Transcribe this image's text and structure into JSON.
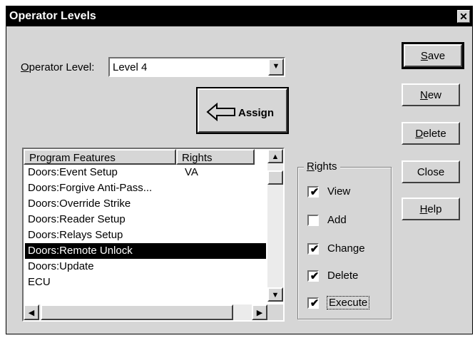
{
  "window": {
    "title": "Operator Levels",
    "close_glyph": "✕"
  },
  "operator_level": {
    "label_prefix": "O",
    "label_rest": "perator Level:",
    "value": "Level 4"
  },
  "assign_button": {
    "label": "Assign",
    "icon": "left-arrow-icon"
  },
  "features_list": {
    "columns": [
      "Program Features",
      "Rights"
    ],
    "rows": [
      {
        "feature": "Doors:Event Setup",
        "rights": "VA"
      },
      {
        "feature": "Doors:Forgive Anti-Pass...",
        "rights": ""
      },
      {
        "feature": "Doors:Override Strike",
        "rights": ""
      },
      {
        "feature": "Doors:Reader Setup",
        "rights": ""
      },
      {
        "feature": "Doors:Relays Setup",
        "rights": ""
      },
      {
        "feature": "Doors:Remote Unlock",
        "rights": "",
        "selected": true
      },
      {
        "feature": "Doors:Update",
        "rights": ""
      },
      {
        "feature": "ECU",
        "rights": ""
      }
    ]
  },
  "rights_group": {
    "title_prefix": "R",
    "title_rest": "ights",
    "items": [
      {
        "label": "View",
        "checked": true
      },
      {
        "label": "Add",
        "checked": false
      },
      {
        "label": "Change",
        "checked": true
      },
      {
        "label": "Delete",
        "checked": true
      },
      {
        "label": "Execute",
        "checked": true
      }
    ]
  },
  "buttons": [
    {
      "prefix": "S",
      "rest": "ave"
    },
    {
      "prefix": "N",
      "rest": "ew"
    },
    {
      "prefix": "D",
      "rest": "elete"
    },
    {
      "prefix": "",
      "rest": "Close"
    },
    {
      "prefix": "H",
      "rest": "elp"
    }
  ],
  "check_glyph": "✔",
  "arrow_glyphs": {
    "down": "▼",
    "up": "▲",
    "right": "▶",
    "left": "◀"
  }
}
